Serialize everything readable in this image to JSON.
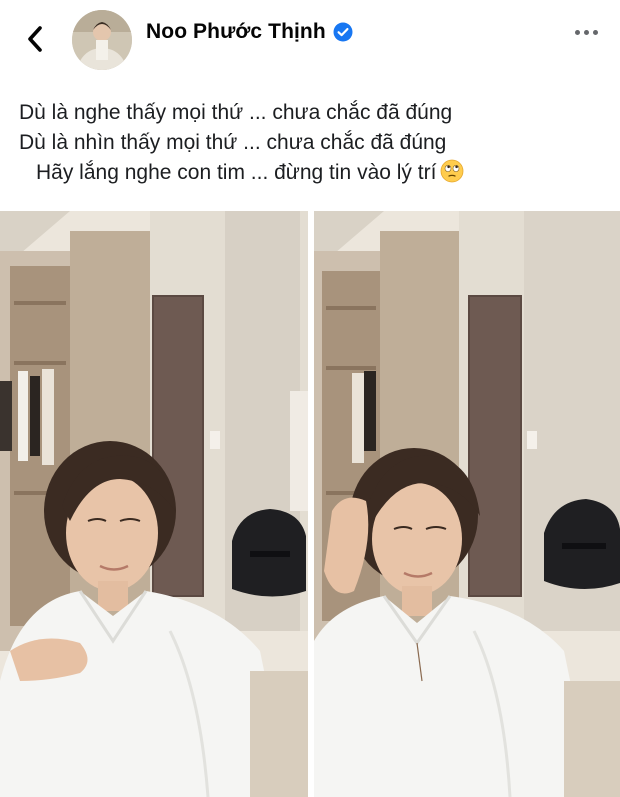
{
  "header": {
    "back_icon": "chevron-left-icon",
    "profile_name": "Noo Phước Thịnh",
    "verified_icon": "verified-badge-icon",
    "more_icon": "more-horizontal-icon"
  },
  "post": {
    "lines": [
      "Dù là nghe thấy mọi thứ ... chưa chắc đã đúng",
      "Dù là nhìn thấy mọi thứ ... chưa chắc đã đúng",
      "Hãy lắng nghe con tim ... đừng tin vào lý trí"
    ],
    "emoji": "face-with-rolling-eyes"
  },
  "colors": {
    "verified_blue": "#1877f2",
    "text": "#1c1e21",
    "icon_gray": "#65676b"
  }
}
